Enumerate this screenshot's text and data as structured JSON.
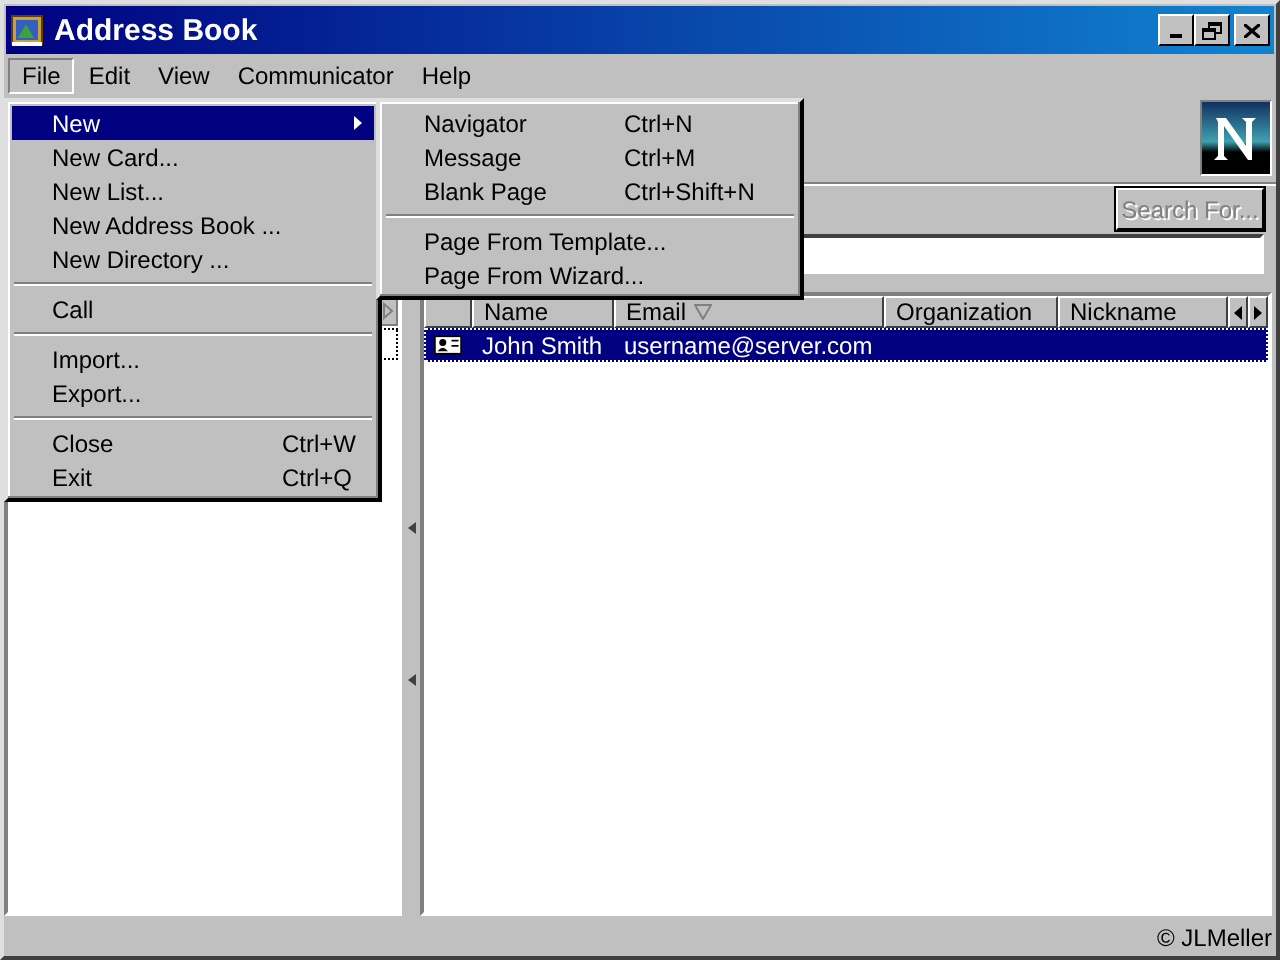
{
  "window": {
    "title": "Address Book"
  },
  "menubar": [
    {
      "label": "File",
      "selected": true
    },
    {
      "label": "Edit",
      "selected": false
    },
    {
      "label": "View",
      "selected": false
    },
    {
      "label": "Communicator",
      "selected": false
    },
    {
      "label": "Help",
      "selected": false
    }
  ],
  "file_menu": {
    "items": [
      {
        "kind": "item",
        "label": "New",
        "submenu": true,
        "selected": true
      },
      {
        "kind": "item",
        "label": "New Card...",
        "submenu": false,
        "selected": false
      },
      {
        "kind": "item",
        "label": "New List...",
        "submenu": false,
        "selected": false
      },
      {
        "kind": "item",
        "label": "New Address Book ...",
        "submenu": false,
        "selected": false
      },
      {
        "kind": "item",
        "label": "New Directory ...",
        "submenu": false,
        "selected": false
      },
      {
        "kind": "separator"
      },
      {
        "kind": "item",
        "label": "Call",
        "submenu": false,
        "selected": false
      },
      {
        "kind": "separator"
      },
      {
        "kind": "item",
        "label": "Import...",
        "submenu": false,
        "selected": false
      },
      {
        "kind": "item",
        "label": "Export...",
        "submenu": false,
        "selected": false
      },
      {
        "kind": "separator"
      },
      {
        "kind": "item",
        "label": "Close",
        "shortcut": "Ctrl+W",
        "submenu": false,
        "selected": false
      },
      {
        "kind": "item",
        "label": "Exit",
        "shortcut": "Ctrl+Q",
        "submenu": false,
        "selected": false
      }
    ]
  },
  "new_submenu": {
    "items": [
      {
        "kind": "item",
        "label": "Navigator",
        "shortcut": "Ctrl+N",
        "selected": false
      },
      {
        "kind": "item",
        "label": "Message",
        "shortcut": "Ctrl+M",
        "selected": false
      },
      {
        "kind": "item",
        "label": "Blank Page",
        "shortcut": "Ctrl+Shift+N",
        "selected": false
      },
      {
        "kind": "separator"
      },
      {
        "kind": "item",
        "label": "Page From Template...",
        "selected": false
      },
      {
        "kind": "item",
        "label": "Page From Wizard...",
        "selected": false
      }
    ]
  },
  "search": {
    "button": "Search For...",
    "disabled": true
  },
  "table": {
    "columns": [
      {
        "label": "Name",
        "sorted": false
      },
      {
        "label": "Email",
        "sorted": true
      },
      {
        "label": "Organization",
        "sorted": false
      },
      {
        "label": "Nickname",
        "sorted": false
      }
    ],
    "rows": [
      {
        "name": "John Smith",
        "email": "username@server.com",
        "selected": true
      }
    ]
  },
  "status_bar": {
    "text": "© JLMeller"
  }
}
